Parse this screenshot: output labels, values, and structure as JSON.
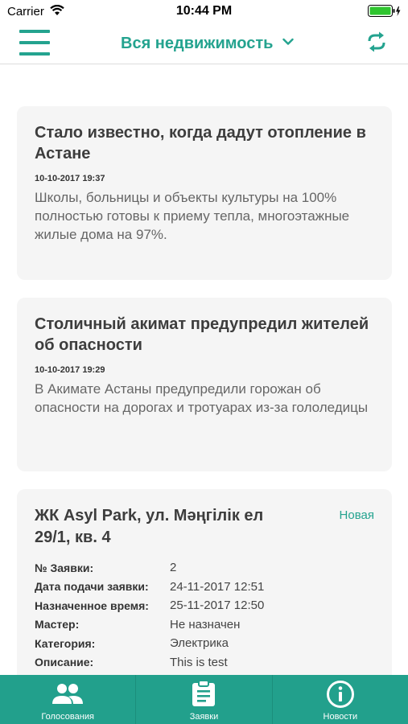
{
  "status_bar": {
    "carrier": "Carrier",
    "time": "10:44 PM"
  },
  "header": {
    "title": "Вся недвижимость",
    "accent_color": "#24a38f"
  },
  "news": [
    {
      "title": "Стало известно, когда дадут отопление в Астане",
      "date": "10-10-2017 19:37",
      "text": "Школы, больницы и объекты культуры на 100% полностью готовы к приему тепла, многоэтажные жилые дома на 97%."
    },
    {
      "title": "Столичный акимат предупредил жителей об опасности",
      "date": "10-10-2017 19:29",
      "text": "В Акимате Астаны предупредили горожан об опасности на дорогах и тротуарах из-за гололедицы"
    }
  ],
  "order": {
    "title": "ЖК Asyl Park, ул. Мәңгілік ел 29/1, кв. 4",
    "status": "Новая",
    "rows": [
      {
        "label": "№ Заявки:",
        "value": "2"
      },
      {
        "label": "Дата подачи заявки:",
        "value": "24-11-2017 12:51"
      },
      {
        "label": "Назначенное время:",
        "value": "25-11-2017 12:50"
      },
      {
        "label": "Мастер:",
        "value": "Не назначен"
      },
      {
        "label": "Категория:",
        "value": "Электрика"
      },
      {
        "label": "Описание:",
        "value": "This is test"
      }
    ]
  },
  "tabs": [
    {
      "label": "Голосования",
      "icon": "people-icon"
    },
    {
      "label": "Заявки",
      "icon": "clipboard-icon"
    },
    {
      "label": "Новости",
      "icon": "info-icon"
    }
  ],
  "tab_bar_color": "#22a08c"
}
